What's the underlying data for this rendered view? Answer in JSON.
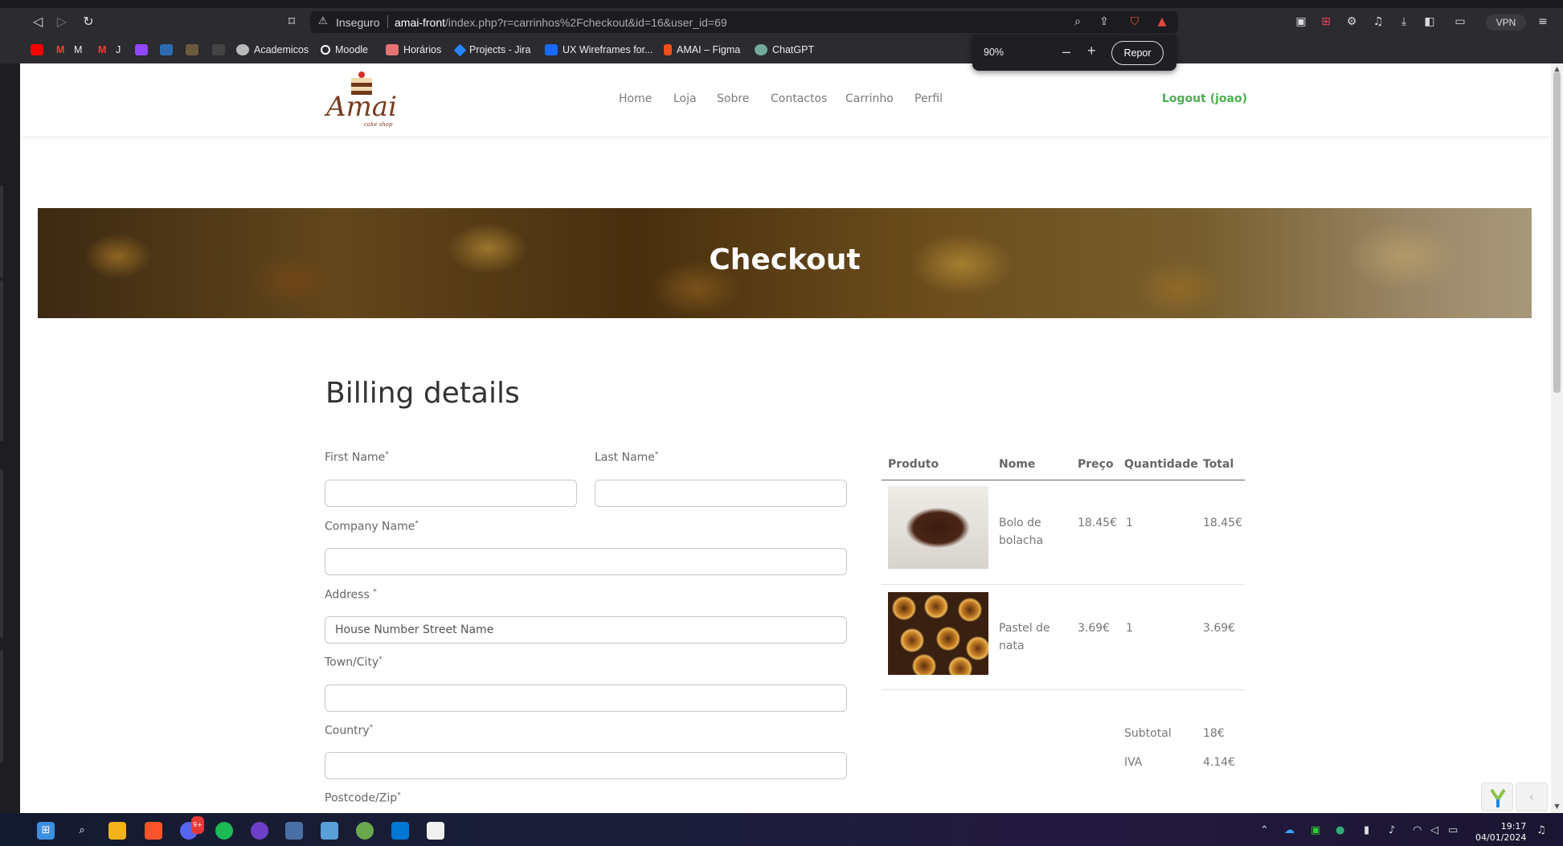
{
  "browser": {
    "url_warning": "Inseguro",
    "url_host": "amai-front",
    "url_path": "/index.php?r=carrinhos%2Fcheckout&id=16&user_id=69",
    "vpn_label": "VPN",
    "zoom": {
      "level": "90%",
      "minus": "–",
      "plus": "+",
      "reset_label": "Repor"
    }
  },
  "bookmarks": [
    {
      "label": "M",
      "icon": "gmail-icon",
      "color": "#ea4335"
    },
    {
      "label": "J",
      "icon": "gmail-icon",
      "color": "#ea4335"
    },
    {
      "label": "Academicos",
      "icon": "globe-icon",
      "color": "#cccccc"
    },
    {
      "label": "Moodle",
      "icon": "moodle-icon",
      "color": "#ffffff"
    },
    {
      "label": "Horários",
      "icon": "calendar-icon",
      "color": "#e57373"
    },
    {
      "label": "Projects - Jira",
      "icon": "jira-icon",
      "color": "#2684ff"
    },
    {
      "label": "UX Wireframes for...",
      "icon": "behance-icon",
      "color": "#1769ff"
    },
    {
      "label": "AMAI – Figma",
      "icon": "figma-icon",
      "color": "#f24e1e"
    },
    {
      "label": "ChatGPT",
      "icon": "chatgpt-icon",
      "color": "#74aa9c"
    }
  ],
  "site": {
    "nav": [
      "Home",
      "Loja",
      "Sobre",
      "Contactos",
      "Carrinho",
      "Perfil"
    ],
    "logout": "Logout (joao)",
    "brand": "Amai",
    "brand_sub": "cake shop",
    "accent_color": "#4caf50"
  },
  "banner": {
    "title": "Checkout"
  },
  "billing": {
    "title": "Billing details",
    "fields": {
      "first_name": {
        "label": "First Name",
        "required": "*",
        "value": ""
      },
      "last_name": {
        "label": "Last Name",
        "required": "*",
        "value": ""
      },
      "company": {
        "label": "Company Name",
        "required": "*",
        "value": ""
      },
      "address": {
        "label": "Address ",
        "required": "*",
        "placeholder": "House Number Street Name"
      },
      "town": {
        "label": "Town/City",
        "required": "*",
        "value": ""
      },
      "country": {
        "label": "Country",
        "required": "*",
        "value": ""
      },
      "postcode": {
        "label": "Postcode/Zip",
        "required": "*"
      }
    }
  },
  "order": {
    "headers": [
      "Produto",
      "Nome",
      "Preço",
      "Quantidade",
      "Total"
    ],
    "items": [
      {
        "name_line1": "Bolo de",
        "name_line2": "bolacha",
        "price": "18.45€",
        "qty": "1",
        "total": "18.45€"
      },
      {
        "name_line1": "Pastel de",
        "name_line2": "nata",
        "price": "3.69€",
        "qty": "1",
        "total": "3.69€"
      }
    ],
    "subtotal_label": "Subtotal",
    "subtotal_value": "18€",
    "iva_label": "IVA",
    "iva_value": "4.14€"
  },
  "taskbar": {
    "time": "19:17",
    "date": "04/01/2024",
    "discord_badge": "9+"
  }
}
